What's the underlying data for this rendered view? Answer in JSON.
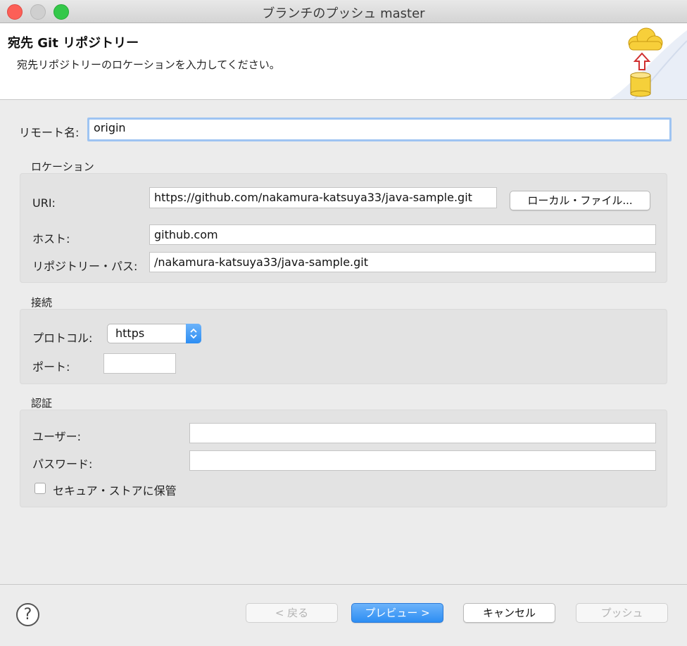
{
  "window": {
    "title": "ブランチのプッシュ master"
  },
  "banner": {
    "title": "宛先 Git リポジトリー",
    "description": "宛先リポジトリーのロケーションを入力してください。",
    "icon": "cloud-upload-database-icon"
  },
  "remote": {
    "label": "リモート名:",
    "value": "origin"
  },
  "location": {
    "title": "ロケーション",
    "uri_label": "URI:",
    "uri_value": "https://github.com/nakamura-katsuya33/java-sample.git",
    "local_file_button": "ローカル・ファイル...",
    "host_label": "ホスト:",
    "host_value": "github.com",
    "path_label": "リポジトリー・パス:",
    "path_value": "/nakamura-katsuya33/java-sample.git"
  },
  "connection": {
    "title": "接続",
    "protocol_label": "プロトコル:",
    "protocol_value": "https",
    "port_label": "ポート:",
    "port_value": ""
  },
  "auth": {
    "title": "認証",
    "user_label": "ユーザー:",
    "user_value": "",
    "password_label": "パスワード:",
    "password_value": "",
    "store_label": "セキュア・ストアに保管",
    "store_checked": false
  },
  "footer": {
    "help_symbol": "?",
    "back": "< 戻る",
    "preview": "プレビュー >",
    "cancel": "キャンセル",
    "push": "プッシュ"
  },
  "colors": {
    "accent": "#2d8ef3",
    "focus_ring": "#9ec4f2",
    "close": "#fc5f57",
    "maximize": "#34c84a"
  }
}
